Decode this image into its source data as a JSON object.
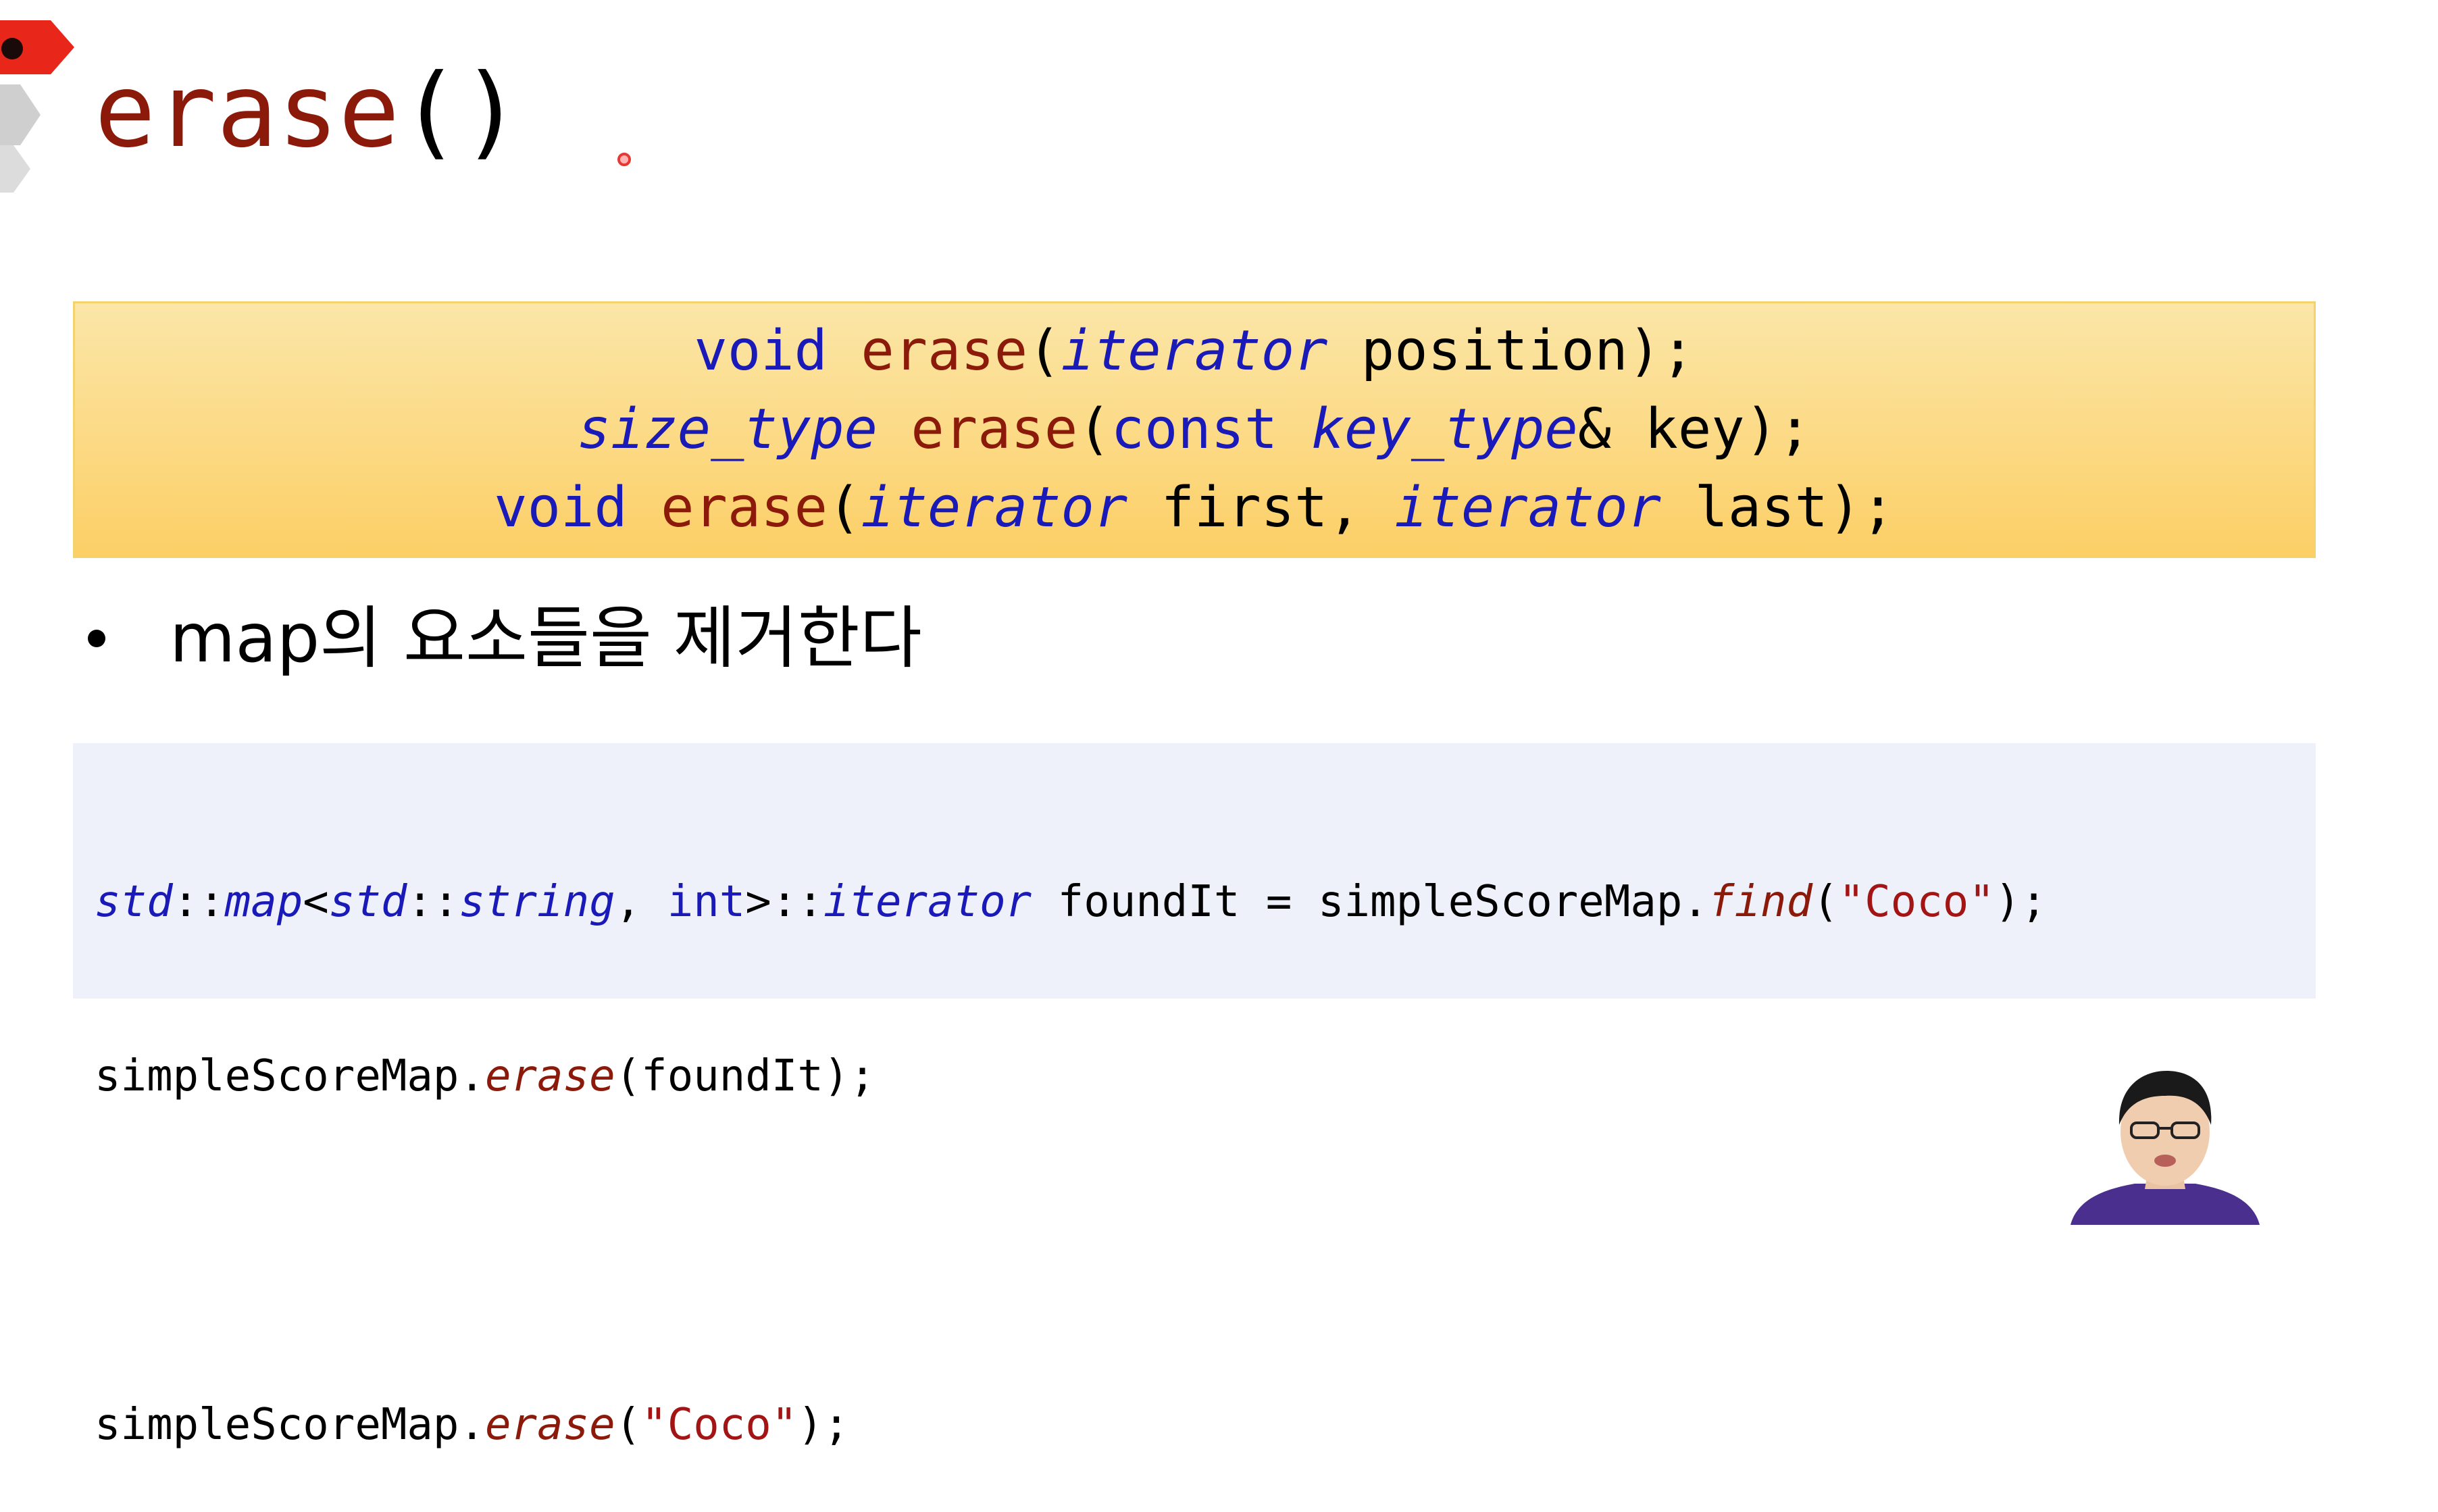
{
  "slide": {
    "title_fn": "erase",
    "title_parens": "()",
    "signatures": {
      "s1": {
        "ret": "void",
        "fn": "erase",
        "open": "(",
        "type1": "iterator",
        "rest": " position);"
      },
      "s2": {
        "ret": "size_type",
        "fn": "erase",
        "open": "(",
        "kw": "const",
        "type1": "key_type",
        "rest": "& key);"
      },
      "s3": {
        "ret": "void",
        "fn": "erase",
        "open": "(",
        "type1": "iterator",
        "mid": " first, ",
        "type2": "iterator",
        "rest": " last);"
      }
    },
    "bullet": "map의 요소들을 제거한다",
    "code": {
      "l1": {
        "a": "std",
        "b": "::",
        "c": "map",
        "d": "<",
        "e": "std",
        "f": "::",
        "g": "string",
        "h": ", ",
        "i": "int",
        "j": ">::",
        "k": "iterator",
        "l": " foundIt = simpleScoreMap.",
        "m": "find",
        "n": "(",
        "o": "\"Coco\"",
        "p": ");"
      },
      "l2": {
        "a": "simpleScoreMap.",
        "b": "erase",
        "c": "(foundIt);"
      },
      "l4": {
        "a": "simpleScoreMap.",
        "b": "erase",
        "c": "(",
        "d": "\"Coco\"",
        "e": ");"
      }
    }
  },
  "colors": {
    "function": "#8b1a0a",
    "keyword": "#1a1ab8",
    "string": "#a31515",
    "signature_bg": "#fcd671",
    "code_bg": "#eef0fa",
    "logo": "#e8261a"
  },
  "icons": {
    "logo": "red-pennant-logo-icon",
    "pointer": "laser-pointer-icon"
  }
}
